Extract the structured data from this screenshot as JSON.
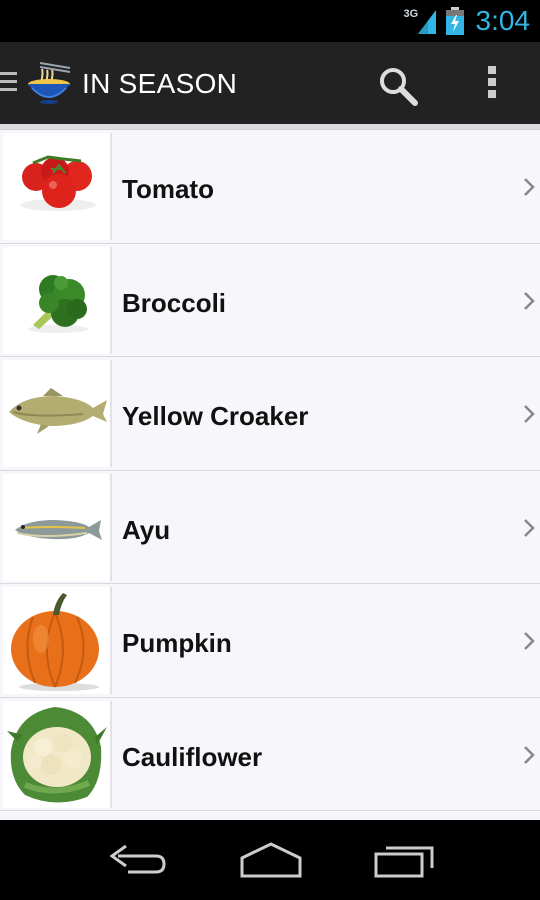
{
  "status_bar": {
    "time": "3:04",
    "network": "3G",
    "signal_icon": "signal-icon",
    "battery_icon": "battery-charging-icon"
  },
  "action_bar": {
    "title": "IN SEASON",
    "app_icon": "noodle-bowl-icon",
    "search_icon": "search-icon",
    "overflow_icon": "overflow-menu-icon",
    "drawer_icon": "drawer-indicator-icon"
  },
  "items": [
    {
      "label": "Tomato",
      "image": "tomato"
    },
    {
      "label": "Broccoli",
      "image": "broccoli"
    },
    {
      "label": "Yellow Croaker",
      "image": "yellow-croaker"
    },
    {
      "label": "Ayu",
      "image": "ayu"
    },
    {
      "label": "Pumpkin",
      "image": "pumpkin"
    },
    {
      "label": "Cauliflower",
      "image": "cauliflower"
    }
  ],
  "nav_bar": {
    "back_icon": "back-icon",
    "home_icon": "home-icon",
    "recents_icon": "recent-apps-icon"
  },
  "colors": {
    "clock": "#33b5e5",
    "action_bar": "#222222",
    "list_bg": "#f7f6fa"
  }
}
